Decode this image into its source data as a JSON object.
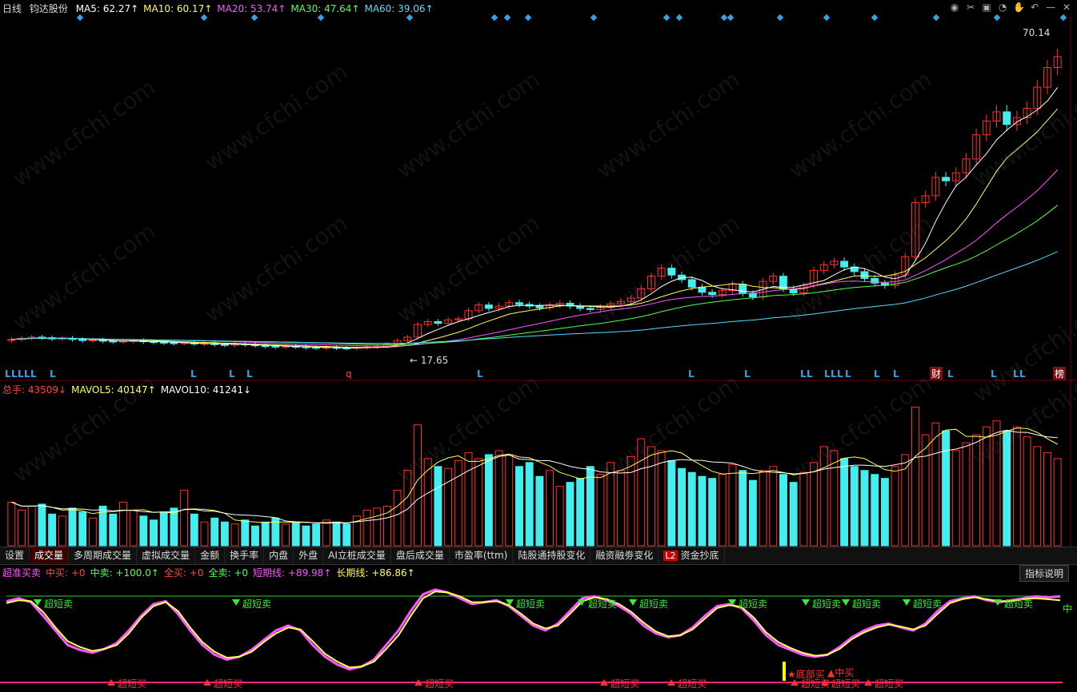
{
  "header": {
    "period": "日线",
    "stock_name": "钧达股份",
    "ma": [
      {
        "label": "MA5: 62.27↑",
        "color": "#ffffff"
      },
      {
        "label": "MA10: 60.17↑",
        "color": "#ffff55"
      },
      {
        "label": "MA20: 53.74↑",
        "color": "#ff55ff"
      },
      {
        "label": "MA30: 47.64↑",
        "color": "#55ff55"
      },
      {
        "label": "MA60: 39.06↑",
        "color": "#55ddff"
      }
    ]
  },
  "toolbar_icons": [
    "eye-icon",
    "scissors-icon",
    "lock-icon",
    "bell-icon",
    "hand-icon",
    "undo-icon",
    "minus-icon",
    "close-icon"
  ],
  "price_labels": {
    "high": "70.14",
    "low": "17.65",
    "tag_cai": "财",
    "tag_bang": "榜",
    "tag_q": "q",
    "l_marker": "L"
  },
  "volume_header": [
    {
      "label": "总手: 43509↓",
      "color": "#ff4444"
    },
    {
      "label": "MAVOL5: 40147↑",
      "color": "#ffff55"
    },
    {
      "label": "MAVOL10: 41241↓",
      "color": "#ffffff"
    }
  ],
  "tabs": [
    "设置",
    "成交量",
    "多周期成交量",
    "虚拟成交量",
    "金额",
    "换手率",
    "内盘",
    "外盘",
    "AI立桩成交量",
    "盘后成交量",
    "市盈率(ttm)",
    "陆股通持股变化",
    "融资融劵变化",
    "资金抄底"
  ],
  "tab_l2": "L2",
  "indicator_header": [
    {
      "label": "超准买卖",
      "color": "#ff55ff"
    },
    {
      "label": "中买: +0",
      "color": "#ff4444"
    },
    {
      "label": "中卖: +100.0↑",
      "color": "#55ff55"
    },
    {
      "label": "全买: +0",
      "color": "#ff4444"
    },
    {
      "label": "全卖: +0",
      "color": "#55ff55"
    },
    {
      "label": "短期线: +89.98↑",
      "color": "#ff55ff"
    },
    {
      "label": "长期线: +86.86↑",
      "color": "#ffff55"
    }
  ],
  "explain_button": "指标说明",
  "signals": {
    "sell": "超短卖",
    "buy": "超短买",
    "bottom_buy": "底部买",
    "mid_buy": "中买",
    "mid": "中"
  },
  "watermark": "www.cfchi.com",
  "chart_data": [
    {
      "type": "candlestick",
      "title": "钧达股份 日线",
      "ylim": [
        15,
        72
      ],
      "high_label": 70.14,
      "low_label": 17.65,
      "close": [
        19.2,
        19.4,
        19.6,
        19.5,
        19.3,
        19.4,
        19.2,
        19.0,
        19.1,
        18.9,
        18.8,
        18.9,
        19.0,
        18.8,
        18.7,
        18.6,
        18.5,
        18.6,
        18.4,
        18.5,
        18.3,
        18.2,
        18.4,
        18.3,
        18.1,
        18.0,
        17.9,
        18.0,
        17.9,
        17.8,
        17.7,
        17.8,
        17.7,
        17.65,
        17.8,
        17.9,
        18.0,
        18.4,
        19.0,
        19.6,
        21.8,
        22.3,
        22.0,
        22.6,
        22.8,
        24.2,
        25.2,
        24.6,
        25.0,
        25.6,
        25.3,
        25.0,
        24.7,
        25.2,
        25.5,
        25.0,
        24.6,
        24.4,
        24.8,
        25.4,
        25.8,
        26.4,
        28.0,
        30.2,
        31.6,
        30.4,
        29.6,
        28.3,
        27.4,
        27.0,
        27.7,
        28.8,
        27.2,
        26.6,
        29.3,
        30.2,
        28.0,
        27.3,
        28.6,
        31.2,
        32.2,
        32.8,
        31.8,
        31.0,
        29.8,
        29.0,
        28.6,
        30.4,
        33.6,
        43.0,
        44.2,
        47.4,
        46.8,
        48.2,
        50.6,
        54.8,
        57.2,
        58.8,
        56.6,
        57.8,
        59.4,
        63.1,
        66.5,
        68.4
      ],
      "ma_lines": [
        {
          "name": "MA5",
          "color": "#ffffff"
        },
        {
          "name": "MA10",
          "color": "#ffff55"
        },
        {
          "name": "MA20",
          "color": "#ff55ff"
        },
        {
          "name": "MA30",
          "color": "#55ff55"
        },
        {
          "name": "MA60",
          "color": "#55ddff"
        }
      ]
    },
    {
      "type": "bar",
      "title": "成交量",
      "values": [
        22,
        18,
        20,
        21,
        16,
        15,
        19,
        17,
        14,
        20,
        16,
        22,
        18,
        15,
        13,
        17,
        19,
        28,
        16,
        12,
        14,
        12,
        11,
        13,
        10,
        12,
        14,
        11,
        12,
        10,
        11,
        13,
        12,
        11,
        15,
        18,
        19,
        20,
        28,
        38,
        61,
        44,
        40,
        39,
        43,
        47,
        44,
        46,
        48,
        46,
        40,
        42,
        35,
        38,
        30,
        32,
        34,
        40,
        36,
        42,
        38,
        45,
        54,
        50,
        48,
        43,
        39,
        37,
        35,
        34,
        36,
        41,
        38,
        33,
        38,
        40,
        36,
        32,
        37,
        42,
        50,
        48,
        44,
        40,
        38,
        36,
        34,
        40,
        46,
        70,
        56,
        62,
        58,
        48,
        52,
        56,
        60,
        63,
        58,
        60,
        55,
        50,
        47,
        44
      ],
      "ylim": [
        0,
        75
      ]
    },
    {
      "type": "line",
      "title": "超准买卖",
      "series": [
        {
          "name": "短期线",
          "color": "#ff55ff",
          "values": [
            85,
            88,
            84,
            70,
            55,
            40,
            35,
            32,
            36,
            42,
            55,
            70,
            82,
            85,
            72,
            55,
            40,
            30,
            25,
            28,
            35,
            45,
            55,
            60,
            55,
            40,
            28,
            20,
            15,
            18,
            25,
            40,
            55,
            75,
            92,
            97,
            94,
            88,
            82,
            84,
            86,
            80,
            70,
            60,
            55,
            62,
            75,
            88,
            90,
            86,
            80,
            72,
            60,
            52,
            48,
            50,
            58,
            70,
            80,
            82,
            78,
            65,
            50,
            40,
            35,
            30,
            28,
            30,
            38,
            48,
            55,
            60,
            62,
            58,
            55,
            62,
            75,
            85,
            88,
            90,
            86,
            84,
            86,
            88,
            90,
            89,
            90
          ]
        },
        {
          "name": "长期线",
          "color": "#ffff55",
          "values": [
            83,
            86,
            85,
            74,
            58,
            44,
            38,
            34,
            36,
            40,
            52,
            68,
            80,
            84,
            75,
            58,
            43,
            33,
            27,
            28,
            33,
            43,
            52,
            58,
            56,
            44,
            31,
            23,
            17,
            18,
            23,
            36,
            50,
            70,
            88,
            95,
            94,
            90,
            84,
            84,
            85,
            81,
            72,
            62,
            57,
            60,
            72,
            85,
            89,
            87,
            82,
            74,
            63,
            54,
            49,
            50,
            56,
            67,
            78,
            81,
            79,
            68,
            53,
            43,
            37,
            32,
            29,
            30,
            36,
            46,
            53,
            58,
            61,
            59,
            56,
            60,
            72,
            83,
            87,
            89,
            87,
            85,
            85,
            87,
            88,
            87,
            86
          ]
        }
      ],
      "ylim": [
        0,
        105
      ]
    }
  ]
}
